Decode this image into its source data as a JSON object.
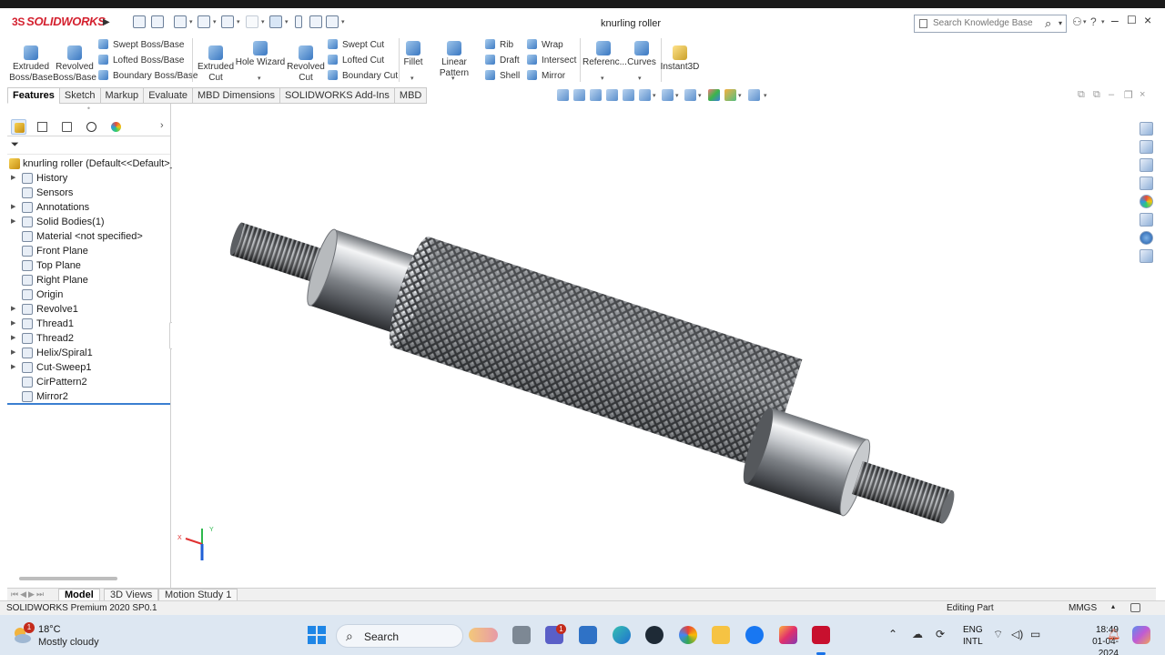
{
  "app": {
    "brand_ds": "3S",
    "brand_name": "SOLIDWORKS",
    "document_title": "knurling roller",
    "search": {
      "placeholder": "Search Knowledge Base"
    }
  },
  "command_manager": {
    "large": [
      {
        "name": "extruded-boss",
        "label": "Extruded\nBoss/Base"
      },
      {
        "name": "revolved-boss",
        "label": "Revolved\nBoss/Base"
      },
      {
        "name": "extruded-cut",
        "label": "Extruded\nCut"
      },
      {
        "name": "hole-wizard",
        "label": "Hole Wizard"
      },
      {
        "name": "revolved-cut",
        "label": "Revolved\nCut"
      },
      {
        "name": "fillet",
        "label": "Fillet"
      },
      {
        "name": "linear-pattern",
        "label": "Linear Pattern"
      },
      {
        "name": "reference",
        "label": "Referenc..."
      },
      {
        "name": "curves",
        "label": "Curves"
      },
      {
        "name": "instant3d",
        "label": "Instant3D"
      }
    ],
    "small": {
      "swept_boss": "Swept Boss/Base",
      "lofted_boss": "Lofted Boss/Base",
      "boundary_boss": "Boundary Boss/Base",
      "swept_cut": "Swept Cut",
      "lofted_cut": "Lofted Cut",
      "boundary_cut": "Boundary Cut",
      "rib": "Rib",
      "draft": "Draft",
      "shell": "Shell",
      "wrap": "Wrap",
      "intersect": "Intersect",
      "mirror": "Mirror"
    },
    "tabs": [
      "Features",
      "Sketch",
      "Markup",
      "Evaluate",
      "MBD Dimensions",
      "SOLIDWORKS Add-Ins",
      "MBD"
    ]
  },
  "feature_tree": {
    "root": "knurling roller  (Default<<Default>_D",
    "items": [
      {
        "label": "History",
        "expandable": true,
        "icon": "history-icon"
      },
      {
        "label": "Sensors",
        "expandable": false,
        "icon": "sensors-icon"
      },
      {
        "label": "Annotations",
        "expandable": true,
        "icon": "annotations-icon"
      },
      {
        "label": "Solid Bodies(1)",
        "expandable": true,
        "icon": "solid-bodies-icon"
      },
      {
        "label": "Material <not specified>",
        "expandable": false,
        "icon": "material-icon"
      },
      {
        "label": "Front Plane",
        "expandable": false,
        "icon": "plane-icon"
      },
      {
        "label": "Top Plane",
        "expandable": false,
        "icon": "plane-icon"
      },
      {
        "label": "Right Plane",
        "expandable": false,
        "icon": "plane-icon"
      },
      {
        "label": "Origin",
        "expandable": false,
        "icon": "origin-icon"
      },
      {
        "label": "Revolve1",
        "expandable": true,
        "icon": "revolve-icon"
      },
      {
        "label": "Thread1",
        "expandable": true,
        "icon": "thread-icon"
      },
      {
        "label": "Thread2",
        "expandable": true,
        "icon": "thread-icon"
      },
      {
        "label": "Helix/Spiral1",
        "expandable": true,
        "icon": "helix-icon"
      },
      {
        "label": "Cut-Sweep1",
        "expandable": true,
        "icon": "cut-sweep-icon"
      },
      {
        "label": "CirPattern2",
        "expandable": false,
        "icon": "circular-pattern-icon"
      },
      {
        "label": "Mirror2",
        "expandable": false,
        "icon": "mirror-icon"
      }
    ]
  },
  "triad": {
    "x": "X",
    "y": "Y"
  },
  "model_tabs": [
    "Model",
    "3D Views",
    "Motion Study 1"
  ],
  "status": {
    "product": "SOLIDWORKS Premium 2020 SP0.1",
    "mode": "Editing Part",
    "units": "MMGS"
  },
  "taskbar": {
    "weather_temp": "18°C",
    "weather_cond": "Mostly cloudy",
    "weather_badge": "1",
    "search_label": "Search",
    "teams_badge": "1",
    "lang_top": "ENG",
    "lang_bottom": "INTL",
    "time": "18:49",
    "date": "01-04-2024"
  },
  "colors": {
    "accent": "#3a7fd1",
    "brand": "#d4212f",
    "taskbar": "#dde7f2"
  }
}
